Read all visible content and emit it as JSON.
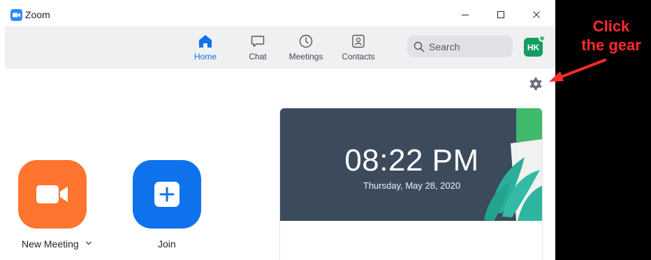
{
  "app": {
    "title": "Zoom"
  },
  "window_controls": {
    "minimize": "minimize",
    "maximize": "maximize",
    "close": "close"
  },
  "nav": {
    "tabs": [
      {
        "label": "Home",
        "icon": "home-icon",
        "active": true
      },
      {
        "label": "Chat",
        "icon": "chat-icon",
        "active": false
      },
      {
        "label": "Meetings",
        "icon": "clock-icon",
        "active": false
      },
      {
        "label": "Contacts",
        "icon": "contacts-icon",
        "active": false
      }
    ],
    "search": {
      "placeholder": "Search",
      "icon": "search-icon"
    },
    "avatar": {
      "initials": "HK",
      "status": "online"
    }
  },
  "settings": {
    "icon": "gear-icon"
  },
  "actions": [
    {
      "label": "New Meeting",
      "icon": "video-camera-icon",
      "has_dropdown": true
    },
    {
      "label": "Join",
      "icon": "plus-icon",
      "has_dropdown": false
    }
  ],
  "clock_card": {
    "time": "08:22 PM",
    "date": "Thursday, May 28, 2020"
  },
  "annotation": {
    "line1": "Click",
    "line2": "the gear"
  },
  "colors": {
    "accent": "#0E72ED",
    "new_meeting": "#FF742E",
    "join": "#0E72ED",
    "avatar": "#149c5e",
    "annotation": "#ff2a2a",
    "card_banner": "#3c4b5c"
  }
}
